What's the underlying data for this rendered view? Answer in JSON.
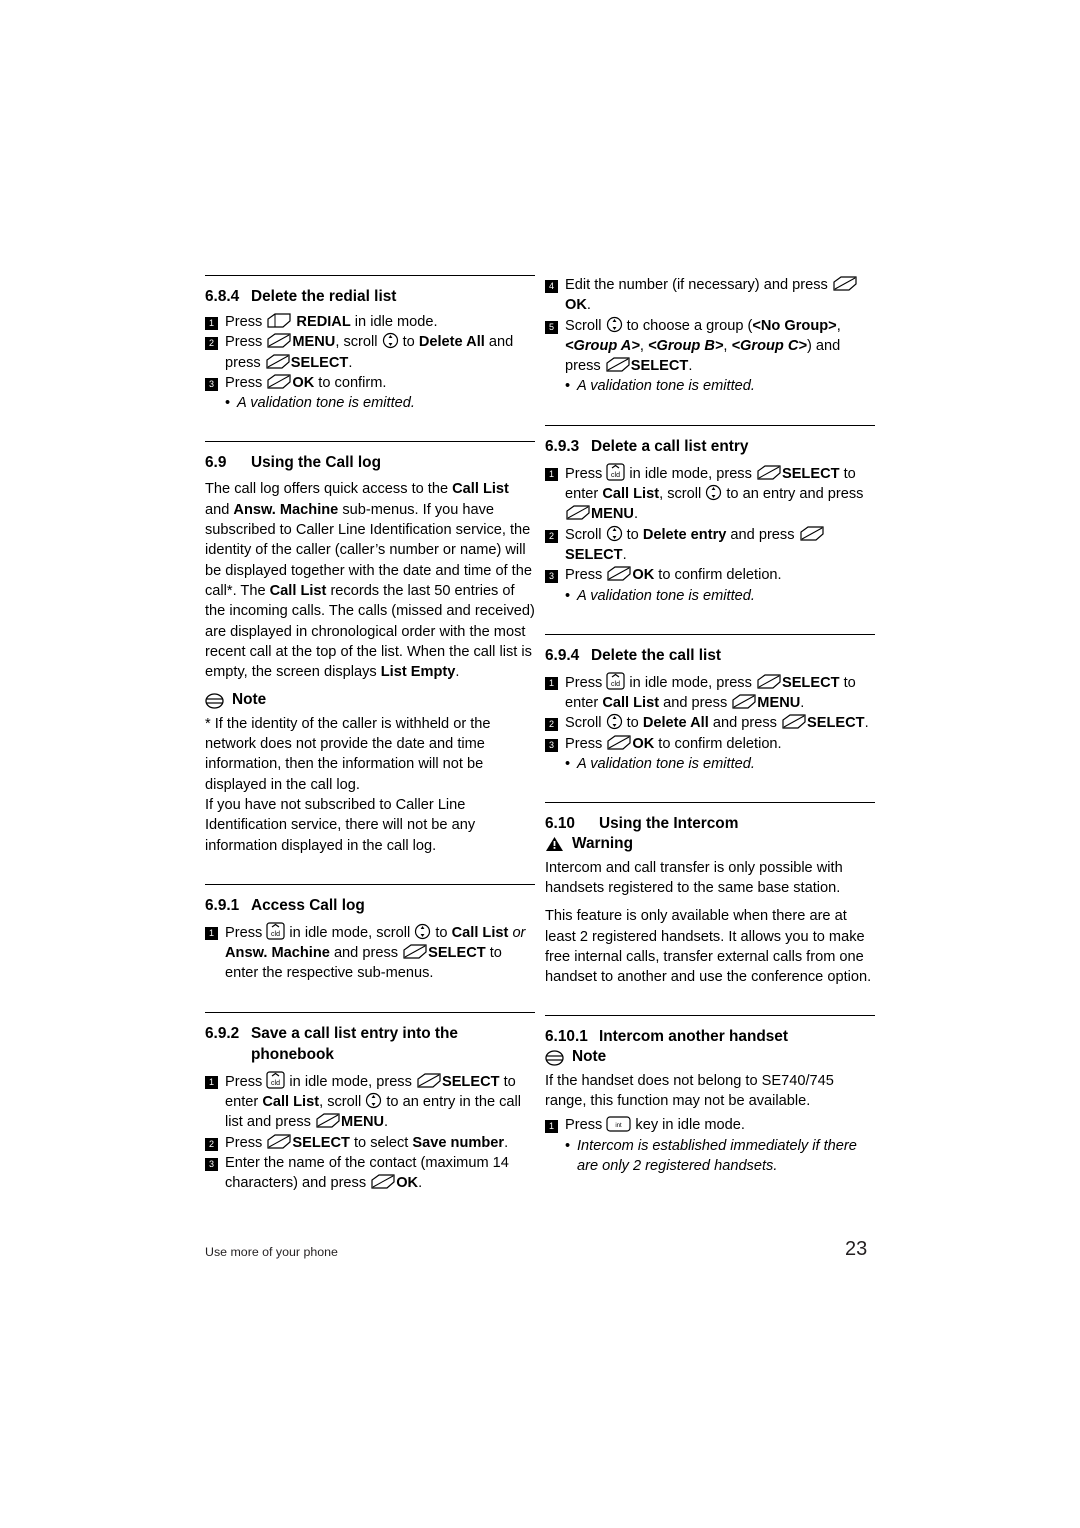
{
  "page": {
    "number": "23",
    "footer_label": "Use more of your phone"
  },
  "left_column": {
    "s684": {
      "num": "6.8.4",
      "title": "Delete the redial list",
      "steps": [
        "Press REDIAL in idle mode.",
        "Press MENU, scroll to Delete All and press SELECT.",
        "Press OK to confirm."
      ],
      "bullet": "A validation tone is emitted."
    },
    "s69": {
      "num": "6.9",
      "title": "Using the Call log",
      "body": "The call log offers quick access to the Call List and Answ. Machine sub-menus. If you have subscribed to Caller Line Identification service, the identity of the caller (caller's number or name) will be displayed together with the date and time of the call*. The Call List records the last 50 entries of the incoming calls. The calls (missed and received) are displayed in chronological order with the most recent call at the top of the list. When the call list is empty, the screen displays List Empty.",
      "note_label": "Note",
      "note_p1": "* If the identity of the caller is withheld or the network does not provide the date and time information, then the information will not be displayed in the call log.",
      "note_p2": "If you have not subscribed to Caller Line Identification service, there will not be any information displayed in the call log."
    },
    "s691": {
      "num": "6.9.1",
      "title": "Access Call log",
      "step1": "Press in idle mode, scroll to Call List or Answ. Machine and press SELECT to enter the respective sub-menus."
    },
    "s692": {
      "num": "6.9.2",
      "title": "Save a call list entry into the",
      "title2": "phonebook",
      "steps": [
        "Press in idle mode, press SELECT to enter Call List, scroll to an entry in the call list and press MENU.",
        "Press SELECT to select Save number.",
        "Enter the name of the contact (maximum 14 characters) and press OK."
      ]
    }
  },
  "right_column": {
    "cont": {
      "step4": "Edit the number (if necessary) and press OK.",
      "step5": "Scroll to choose a group (<No Group>, <Group A>, <Group B>, <Group C>) and press SELECT.",
      "bullet": "A validation tone is emitted."
    },
    "s693": {
      "num": "6.9.3",
      "title": "Delete a call list entry",
      "steps": [
        "Press in idle mode, press SELECT to enter Call List, scroll to an entry and press MENU.",
        "Scroll to Delete entry and press SELECT.",
        "Press OK to confirm deletion."
      ],
      "bullet": "A validation tone is emitted."
    },
    "s694": {
      "num": "6.9.4",
      "title": "Delete the call list",
      "steps": [
        "Press in idle mode, press SELECT to enter Call List and press MENU.",
        "Scroll to Delete All and press SELECT.",
        "Press OK to confirm deletion."
      ],
      "bullet": "A validation tone is emitted."
    },
    "s610": {
      "num": "6.10",
      "title": "Using the Intercom",
      "warning_label": "Warning",
      "p1": "Intercom and call transfer is only possible with handsets registered to the same base station.",
      "p2": "This feature is only available when there are at least 2 registered handsets. It allows you to make free internal calls, transfer external calls from one handset to another and use the conference option."
    },
    "s6101": {
      "num": "6.10.1",
      "title": "Intercom another handset",
      "note_label": "Note",
      "p1": "If the handset does not belong to SE740/745 range, this function may not be available.",
      "step1": "Press key in idle mode.",
      "bullet": "Intercom is established immediately if there are only 2 registered handsets."
    }
  },
  "labels": {
    "press": "Press",
    "scroll": "Scroll",
    "to": "to",
    "and": "and",
    "or": "or",
    "in_idle_mode": "in idle mode.",
    "redial": "REDIAL",
    "menu": "MENU",
    "select": "SELECT",
    "ok": "OK",
    "delete_all": "Delete All",
    "delete_entry": "Delete entry",
    "call_list": "Call List",
    "answ_machine": "Answ. Machine",
    "save_number": "Save number",
    "list_empty": "List Empty"
  }
}
